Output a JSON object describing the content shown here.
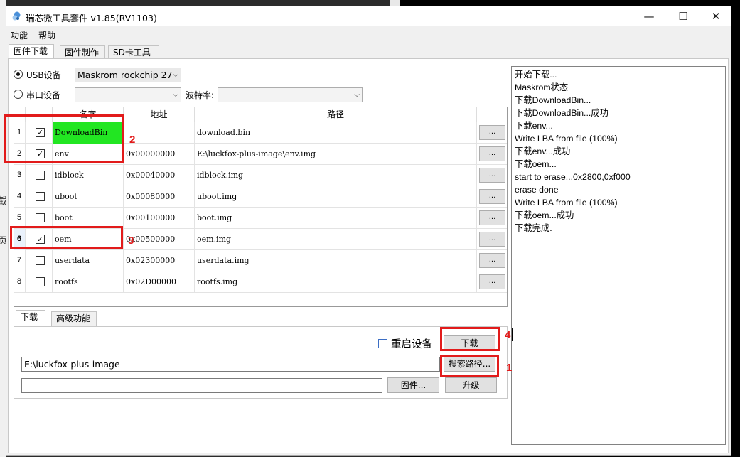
{
  "window": {
    "title": "瑞芯微工具套件 v1.85(RV1103)",
    "controls": {
      "minimize": "—",
      "maximize": "☐",
      "close": "✕"
    }
  },
  "background_glyphs": [
    "截",
    "页"
  ],
  "menu": [
    "功能",
    "帮助"
  ],
  "main_tabs": [
    {
      "label": "固件下载",
      "active": true
    },
    {
      "label": "固件制作",
      "active": false
    },
    {
      "label": "SD卡工具",
      "active": false
    }
  ],
  "device": {
    "usb_label": "USB设备",
    "usb_selected": true,
    "usb_combo_value": "Maskrom rockchip 27",
    "serial_label": "串口设备",
    "serial_selected": false,
    "serial_combo_value": "",
    "baud_label": "波特率:",
    "baud_combo_value": ""
  },
  "table": {
    "headers": {
      "num": "",
      "check": "",
      "name": "名字",
      "address": "地址",
      "path": "路径",
      "action": ""
    },
    "rows": [
      {
        "num": "1",
        "checked": "✓",
        "name": "DownloadBin",
        "address": "",
        "path": "download.bin",
        "highlight": true,
        "selected": false
      },
      {
        "num": "2",
        "checked": "✓",
        "name": "env",
        "address": "0x00000000",
        "path": "E:\\luckfox-plus-image\\env.img",
        "highlight": false,
        "selected": false
      },
      {
        "num": "3",
        "checked": "",
        "name": "idblock",
        "address": "0x00040000",
        "path": "idblock.img",
        "highlight": false,
        "selected": false
      },
      {
        "num": "4",
        "checked": "",
        "name": "uboot",
        "address": "0x00080000",
        "path": "uboot.img",
        "highlight": false,
        "selected": false
      },
      {
        "num": "5",
        "checked": "",
        "name": "boot",
        "address": "0x00100000",
        "path": "boot.img",
        "highlight": false,
        "selected": false
      },
      {
        "num": "6",
        "checked": "✓",
        "name": "oem",
        "address": "0x00500000",
        "path": "oem.img",
        "highlight": false,
        "selected": true
      },
      {
        "num": "7",
        "checked": "",
        "name": "userdata",
        "address": "0x02300000",
        "path": "userdata.img",
        "highlight": false,
        "selected": false
      },
      {
        "num": "8",
        "checked": "",
        "name": "rootfs",
        "address": "0x02D00000",
        "path": "rootfs.img",
        "highlight": false,
        "selected": false
      }
    ],
    "row_button_label": "...",
    "highlight_color": "#22e622"
  },
  "sub_tabs": [
    {
      "label": "下载",
      "active": true
    },
    {
      "label": "高级功能",
      "active": false
    }
  ],
  "download_panel": {
    "restart_label": "重启设备",
    "restart_checked": false,
    "download_button": "下载",
    "path_value": "E:\\luckfox-plus-image",
    "search_button": "搜索路径...",
    "firmware_value": "",
    "firmware_button": "固件...",
    "upgrade_button": "升级"
  },
  "log": [
    "开始下载...",
    "Maskrom状态",
    "下载DownloadBin...",
    "下载DownloadBin...成功",
    "下载env...",
    "Write LBA from file (100%)",
    "下载env...成功",
    "下载oem...",
    "start to erase...0x2800,0xf000",
    "erase done",
    "Write LBA from file (100%)",
    "下载oem...成功",
    "下载完成."
  ],
  "annotations": {
    "color": "#e21b1b",
    "labels": {
      "search_path": "1",
      "rows_1_2": "2",
      "row_6": "3",
      "download": "4"
    }
  }
}
